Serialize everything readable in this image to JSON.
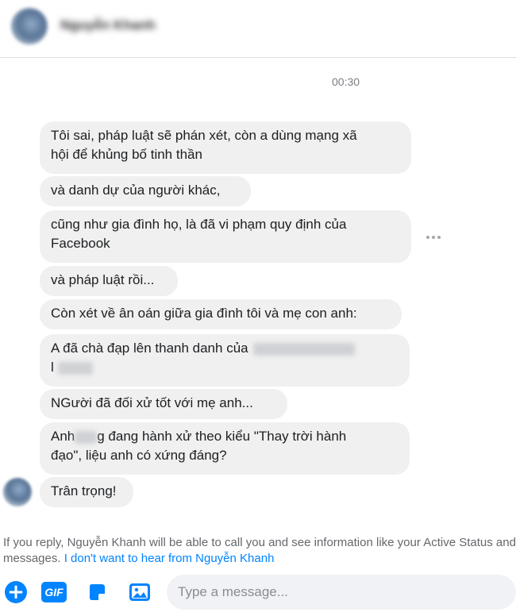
{
  "header": {
    "contact_name": "Nguyễn Khanh"
  },
  "timestamp": "00:30",
  "messages": [
    {
      "line1": "Tôi sai, pháp luật sẽ phán xét, còn a dùng mạng xã",
      "line2": "hội để khủng bố tinh thần"
    },
    {
      "line1": "và danh dự của người khác,"
    },
    {
      "line1": "cũng như gia đình họ, là đã vi phạm quy định của",
      "line2": "Facebook"
    },
    {
      "line1": "và pháp luật rồi..."
    },
    {
      "line1": "Còn xét về ân oán giữa gia đình tôi và mẹ con anh:"
    },
    {
      "line1": "A đã chà đạp lên thanh danh của",
      "line2": "l"
    },
    {
      "line1": "NGười đã đối xử tốt với mẹ anh..."
    },
    {
      "line1_a": "Anh",
      "line1_b": "g đang hành xử theo kiểu \"Thay trời hành",
      "line2": "đạo\", liệu anh có xứng đáng?"
    },
    {
      "line1": "Trân trọng!"
    }
  ],
  "footer": {
    "notice": "If you reply, Nguyễn Khanh will be able to call you and see information like your Active Status and when you've read",
    "notice_line2": "messages.",
    "opt_out_link": "I don't want to hear from Nguyễn Khanh"
  },
  "composer": {
    "placeholder": "Type a message...",
    "plus_glyph": "+",
    "gif_label": "GIF"
  },
  "icons": [
    "more-options-icon",
    "plus-icon",
    "gif-icon",
    "sticker-icon",
    "photo-icon"
  ],
  "colors": {
    "accent": "#0084ff",
    "bubble": "#f0f0f0",
    "muted_text": "#65676b"
  }
}
